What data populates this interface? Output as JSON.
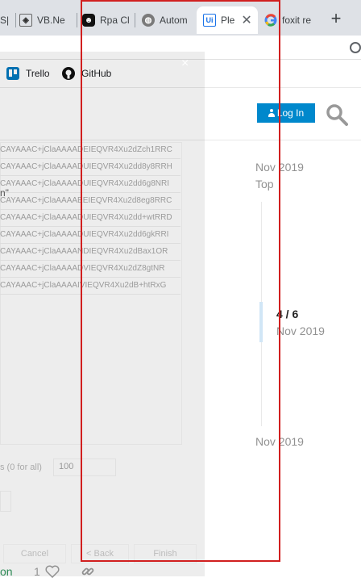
{
  "tabs": [
    {
      "label": "S|",
      "icon": "generic-icon"
    },
    {
      "label": "VB.Ne",
      "icon": "vb-icon"
    },
    {
      "label": "Rpa Cl",
      "icon": "robot-icon"
    },
    {
      "label": "Autom",
      "icon": "globe-icon"
    },
    {
      "label": "Ple",
      "icon": "uipath-icon",
      "active": true
    },
    {
      "label": "foxit re",
      "icon": "google-icon"
    }
  ],
  "new_tab_label": "+",
  "bookmarks": [
    {
      "label": "Trello",
      "icon": "trello-icon"
    },
    {
      "label": "GitHub",
      "icon": "github-icon"
    }
  ],
  "header": {
    "login_label": "Log In"
  },
  "timeline": {
    "top_date": "Nov 2019",
    "top_label": "Top",
    "position": "4 / 6",
    "position_date": "Nov 2019",
    "bottom_date": "Nov 2019"
  },
  "dialog": {
    "close_glyph": "×",
    "lines": [
      "CAYAAAC+jClaAAAADEIEQVR4Xu2dZch1RRC",
      "CAYAAAC+jClaAAAADUIEQVR4Xu2dd8y8RRH",
      "CAYAAAC+jClaAAAADUIEQVR4Xu2dd6g8NRI",
      "CAYAAAC+jClaAAAAEEIEQVR4Xu2d8eg8RRC",
      "CAYAAAC+jClaAAAADUIEQVR4Xu2dd+wtRRD",
      "CAYAAAC+jClaAAAADUIEQVR4Xu2dd6gkRRI",
      "CAYAAAC+jClaAAAANDIEQVR4Xu2dBax1OR",
      "CAYAAAC+jClaAAAADVIEQVR4Xu2dZ8gtNR",
      "CAYAAAC+jClaAAAAIVIEQVR4Xu2dB+htRxG"
    ],
    "quote_fragment": "n\"",
    "max_label": "s (0 for all)",
    "max_value": "100",
    "cancel_label": "Cancel",
    "back_label": "< Back",
    "finish_label": "Finish"
  },
  "footer": {
    "partial_text": "on",
    "like_count": "1"
  },
  "colors": {
    "accent": "#0088cc",
    "annotation": "#d11f1f"
  }
}
